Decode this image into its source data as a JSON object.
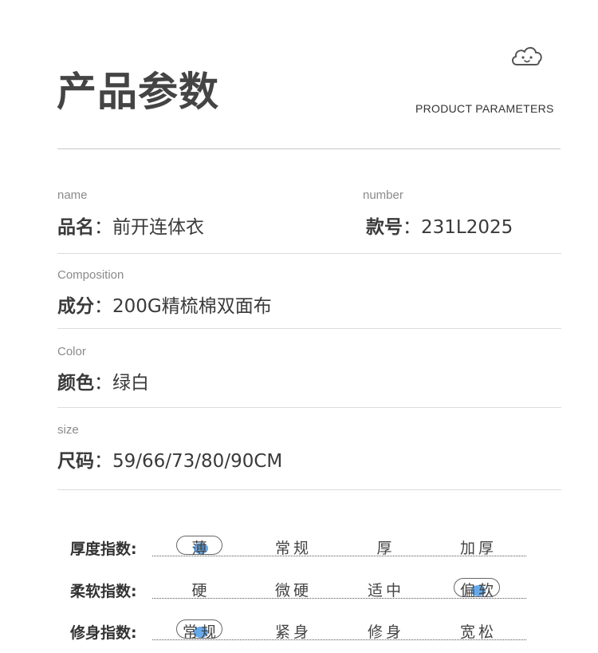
{
  "header": {
    "title": "产品参数",
    "subtitle": "PRODUCT PARAMETERS",
    "logo_icon": "cloud-smile-icon"
  },
  "params": {
    "name": {
      "en": "name",
      "label": "品名",
      "sep": "：",
      "value": "前开连体衣"
    },
    "number": {
      "en": "number",
      "label": "款号",
      "sep": "：",
      "value": "231L2025"
    },
    "composition": {
      "en": "Composition",
      "label": "成分",
      "sep": "：",
      "value": "200G精梳棉双面布"
    },
    "color": {
      "en": "Color",
      "label": "颜色",
      "sep": "：",
      "value": "绿白"
    },
    "size": {
      "en": "size",
      "label": "尺码",
      "sep": "：",
      "value": "59/66/73/80/90CM"
    }
  },
  "indices": [
    {
      "label": "厚度指数:",
      "options": [
        "薄",
        "常规",
        "厚",
        "加厚"
      ],
      "selected": 0
    },
    {
      "label": "柔软指数:",
      "options": [
        "硬",
        "微硬",
        "适中",
        "偏软"
      ],
      "selected": 3
    },
    {
      "label": "修身指数:",
      "options": [
        "常规",
        "紧身",
        "修身",
        "宽松"
      ],
      "selected": 0
    }
  ],
  "colors": {
    "accent_dot": "#4a9bea",
    "text": "#3a3a3a",
    "muted": "#8a8a8a"
  }
}
